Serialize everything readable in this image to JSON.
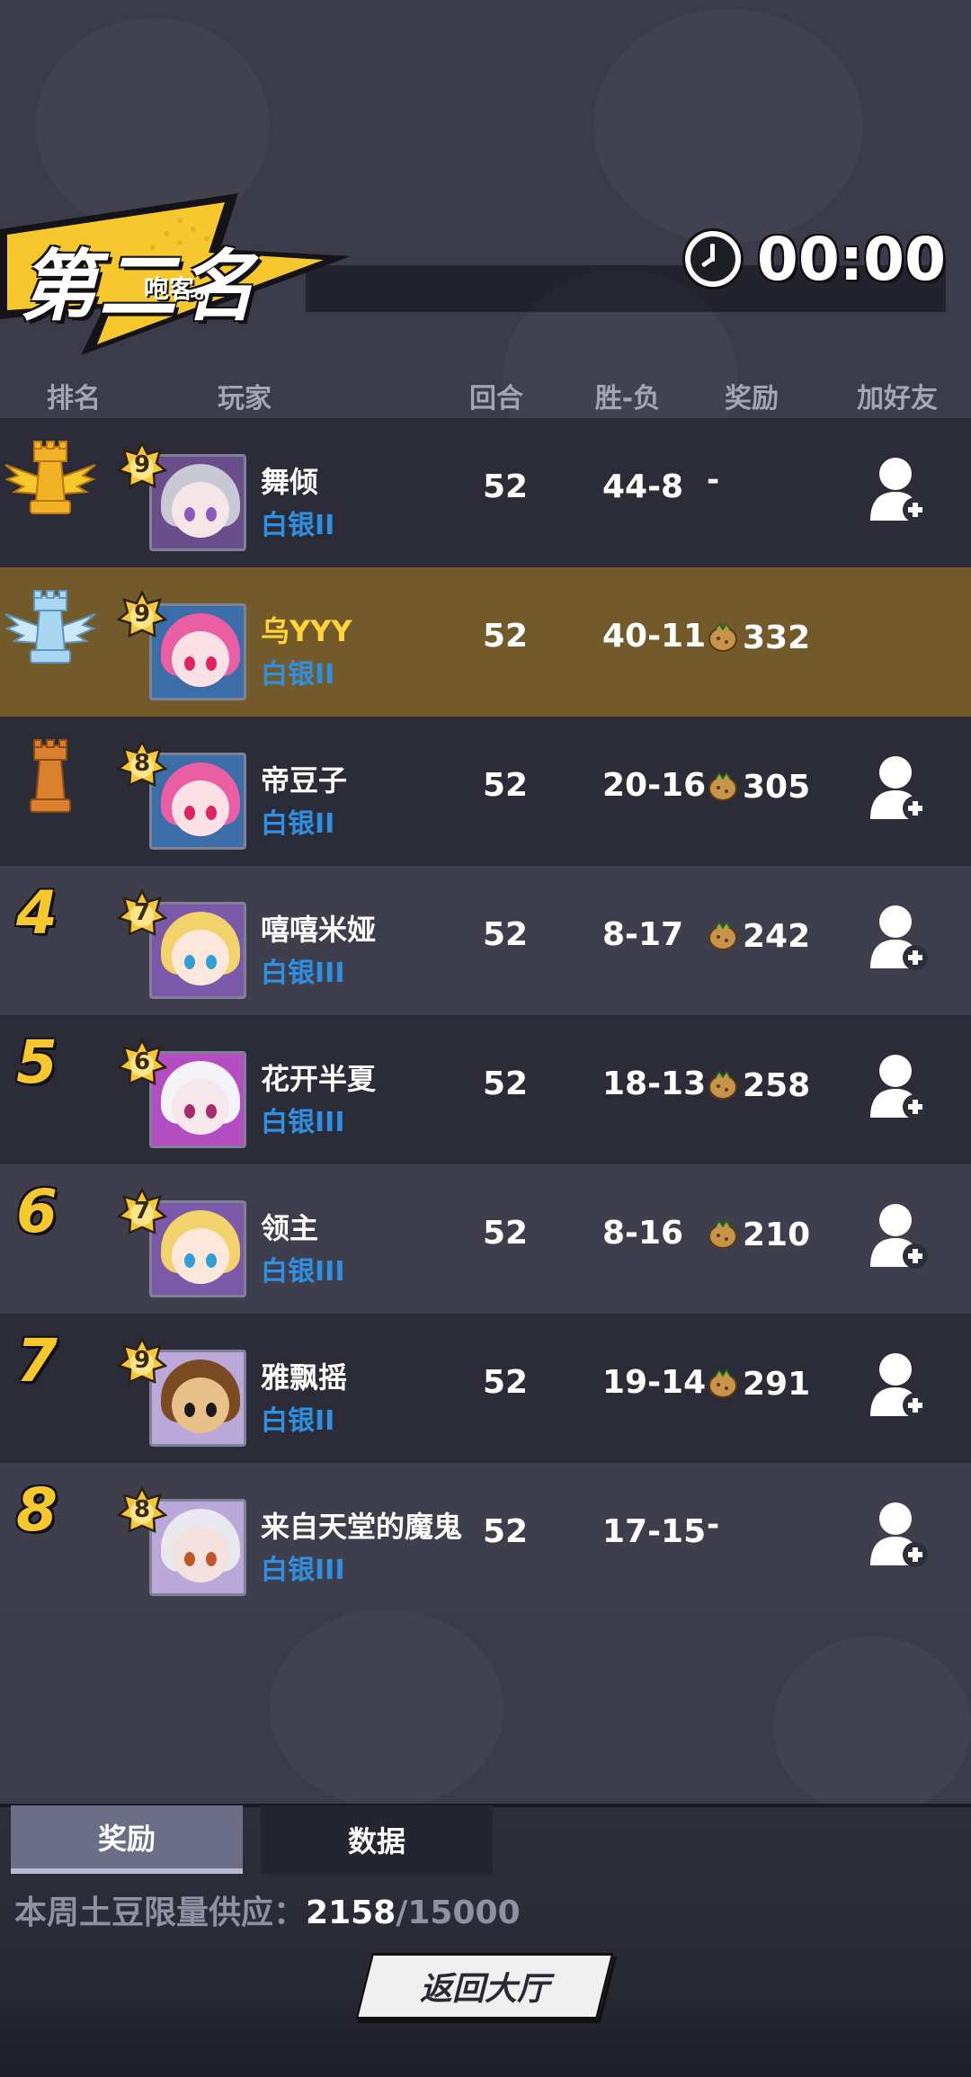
{
  "header": {
    "rank_title": "第二名",
    "player_tag": "咆客。",
    "timer": "00:00"
  },
  "columns": {
    "rank": "排名",
    "player": "玩家",
    "rounds": "回合",
    "record": "胜-负",
    "reward": "奖励",
    "add_friend": "加好友"
  },
  "rows": [
    {
      "rank": "1",
      "trophy": "gold-rook-icon",
      "level": "9",
      "name": "舞倾",
      "tier": "白银II",
      "rounds": "52",
      "record": "44-8",
      "reward": "-",
      "has_reward_icon": false,
      "self": false
    },
    {
      "rank": "2",
      "trophy": "silver-rook-icon",
      "level": "9",
      "name": "乌YYY",
      "tier": "白银II",
      "rounds": "52",
      "record": "40-11",
      "reward": "332",
      "has_reward_icon": true,
      "self": true
    },
    {
      "rank": "3",
      "trophy": "bronze-rook-icon",
      "level": "8",
      "name": "帝豆子",
      "tier": "白银II",
      "rounds": "52",
      "record": "20-16",
      "reward": "305",
      "has_reward_icon": true,
      "self": false
    },
    {
      "rank": "4",
      "level": "7",
      "name": "嘻嘻米娅",
      "tier": "白银III",
      "rounds": "52",
      "record": "8-17",
      "reward": "242",
      "has_reward_icon": true,
      "self": false
    },
    {
      "rank": "5",
      "level": "6",
      "name": "花开半夏",
      "tier": "白银III",
      "rounds": "52",
      "record": "18-13",
      "reward": "258",
      "has_reward_icon": true,
      "self": false
    },
    {
      "rank": "6",
      "level": "7",
      "name": "领主",
      "tier": "白银III",
      "rounds": "52",
      "record": "8-16",
      "reward": "210",
      "has_reward_icon": true,
      "self": false
    },
    {
      "rank": "7",
      "level": "9",
      "name": "雅飘摇",
      "tier": "白银II",
      "rounds": "52",
      "record": "19-14",
      "reward": "291",
      "has_reward_icon": true,
      "self": false
    },
    {
      "rank": "8",
      "level": "8",
      "name": "来自天堂的魔鬼",
      "tier": "白银III",
      "rounds": "52",
      "record": "17-15",
      "reward": "-",
      "has_reward_icon": false,
      "self": false
    }
  ],
  "tabs": {
    "reward": "奖励",
    "data": "数据"
  },
  "supply": {
    "label": "本周土豆限量供应：",
    "current": "2158",
    "max": "/15000"
  },
  "back_button": "返回大厅",
  "colors": {
    "background": "#3b3b4a",
    "row_dark": "#2c2c39",
    "row_light": "#3e3e4d",
    "self_row": "#735a2b",
    "rank_number": "#f7c82d",
    "tier_text": "#2f8fe0",
    "self_name": "#ffd43b"
  }
}
